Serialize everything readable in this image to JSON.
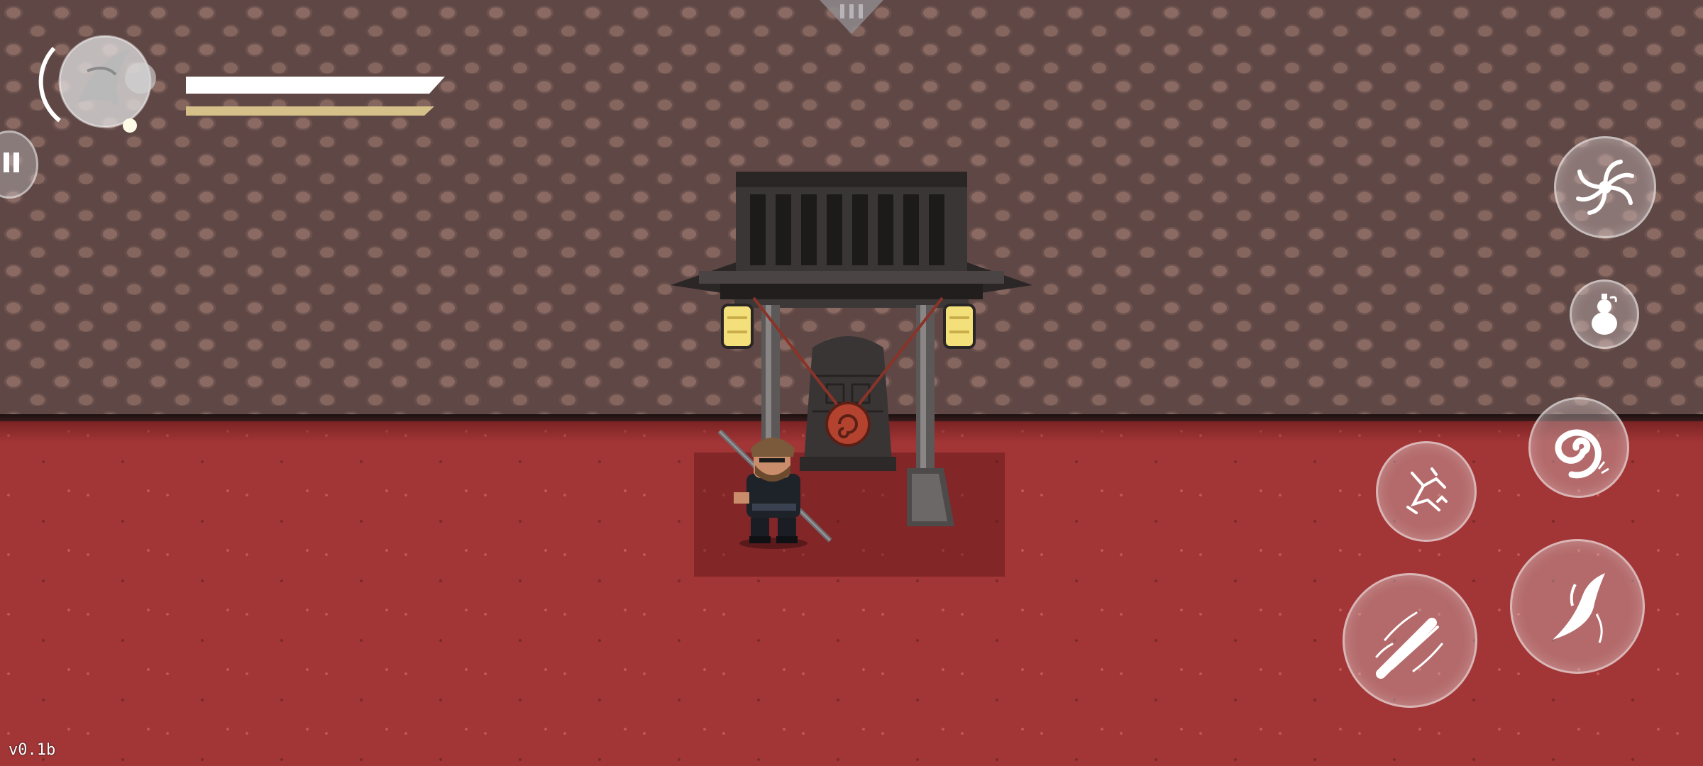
{
  "hud": {
    "health_percent": 100,
    "stamina_percent": 100,
    "version": "v0.1b"
  },
  "colors": {
    "floor": "#a23536",
    "wall": "#5e4744",
    "health": "#ffffff",
    "stamina": "#d4c088",
    "lantern": "#f4e07a"
  },
  "skills": [
    {
      "name": "spin-skill-icon"
    },
    {
      "name": "gourd-icon"
    },
    {
      "name": "spiral-skill-icon"
    },
    {
      "name": "stance-skill-icon"
    },
    {
      "name": "heavy-attack-icon"
    },
    {
      "name": "light-attack-icon"
    }
  ]
}
